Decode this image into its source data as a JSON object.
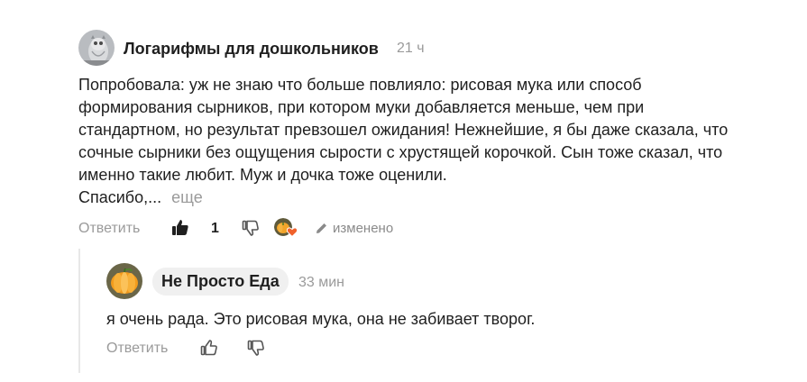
{
  "comment": {
    "author": "Логарифмы для дошкольников",
    "time": "21 ч",
    "text_lines": [
      "Попробовала: уж не знаю что больше повлияло: рисовая мука или способ",
      "формирования сырников, при котором муки добавляется меньше, чем при",
      "стандартном, но результат превзошел ожидания! Нежнейшие, я бы даже сказала, что",
      "сочные сырники без ощущения сырости с хрустящей корочкой. Сын тоже сказал, что",
      "именно такие любит. Муж и дочка тоже оценили.",
      "Спасибо,..."
    ],
    "more_label": "еще",
    "reply_label": "Ответить",
    "like_count": "1",
    "edited_label": "изменено",
    "icons": [
      "like-filled-icon",
      "dislike-icon",
      "author-reaction-avatar",
      "pencil-icon"
    ]
  },
  "reply": {
    "author": "Не Просто Еда",
    "time": "33 мин",
    "text": "я очень рада. Это рисовая мука, она не забивает творог.",
    "reply_label": "Ответить",
    "icons": [
      "like-icon",
      "dislike-icon"
    ]
  },
  "colors": {
    "muted": "#9a9a9a",
    "text": "#1f1f1f",
    "pill": "#f0f0f0",
    "heart": "#f0612b"
  }
}
